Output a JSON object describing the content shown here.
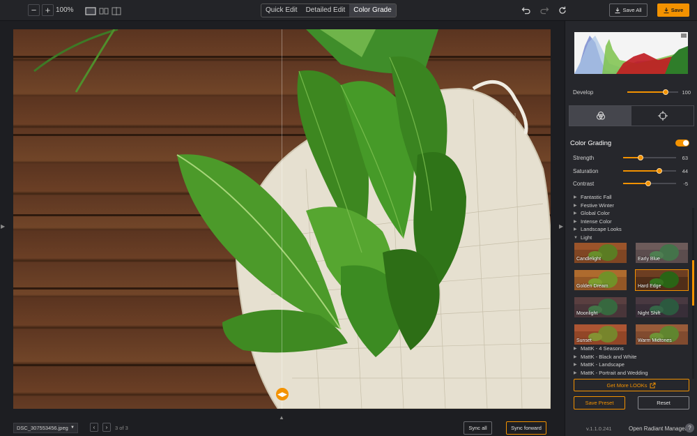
{
  "toolbar": {
    "zoom_out": "−",
    "zoom_in": "+",
    "zoom_level": "100%",
    "modes": [
      "Quick Edit",
      "Detailed Edit",
      "Color Grade"
    ],
    "active_mode": "Color Grade",
    "save_all_label": "Save All",
    "save_label": "Save",
    "accent_color": "#f39200"
  },
  "bottom": {
    "filename": "DSC_307553456.jpeg",
    "page_count": "3 of 3",
    "sync_all": "Sync all",
    "sync_forward": "Sync forward"
  },
  "panel": {
    "develop": {
      "label": "Develop",
      "value": "100",
      "level": 0.75
    },
    "section_title": "Color Grading",
    "sliders": [
      {
        "label": "Strength",
        "value": "63",
        "level": 0.33
      },
      {
        "label": "Saturation",
        "value": "44",
        "level": 0.69
      },
      {
        "label": "Contrast",
        "value": "-5",
        "level": 0.47
      }
    ],
    "tree_top": [
      "Fantastic Fall",
      "Festive Winter",
      "Global Color",
      "Intense Color",
      "Landscape Looks"
    ],
    "tree_open": "Light",
    "presets": [
      "Candlelight",
      "Early Blue",
      "Golden Dream",
      "Hard Edge",
      "Moonlight",
      "Night Shift",
      "Sunset",
      "Warm Midtones"
    ],
    "selected_preset": "Hard Edge",
    "tree_bottom": [
      "MattK - 4 Seasons",
      "MattK - Black and White",
      "MattK - Landscape",
      "MattK - Portrait and Wedding"
    ],
    "get_more": "Get More LOOKs",
    "save_preset": "Save Preset",
    "reset": "Reset",
    "version": "v.1.1.0.241",
    "manager": "Open Radiant Manager",
    "help": "?"
  }
}
